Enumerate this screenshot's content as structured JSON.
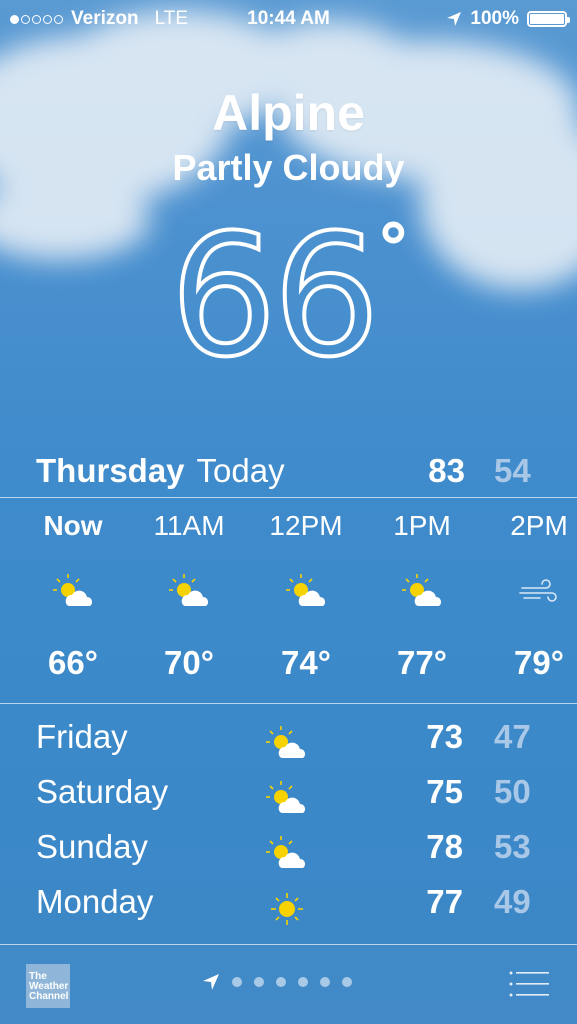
{
  "status_bar": {
    "carrier": "Verizon",
    "network": "LTE",
    "time": "10:44 AM",
    "battery": "100%",
    "signal_bars": 1
  },
  "location": {
    "city": "Alpine",
    "condition": "Partly Cloudy",
    "temperature": "66",
    "degree_symbol": "°"
  },
  "today": {
    "day": "Thursday",
    "label": "Today",
    "high": "83",
    "low": "54"
  },
  "hourly": [
    {
      "time": "Now",
      "icon": "partly-cloudy-icon",
      "temp": "66°"
    },
    {
      "time": "11AM",
      "icon": "partly-cloudy-icon",
      "temp": "70°"
    },
    {
      "time": "12PM",
      "icon": "partly-cloudy-icon",
      "temp": "74°"
    },
    {
      "time": "1PM",
      "icon": "partly-cloudy-icon",
      "temp": "77°"
    },
    {
      "time": "2PM",
      "icon": "wind-icon",
      "temp": "79°"
    }
  ],
  "daily": [
    {
      "day": "Friday",
      "icon": "partly-cloudy-icon",
      "high": "73",
      "low": "47"
    },
    {
      "day": "Saturday",
      "icon": "partly-cloudy-icon",
      "high": "75",
      "low": "50"
    },
    {
      "day": "Sunday",
      "icon": "partly-cloudy-icon",
      "high": "78",
      "low": "53"
    },
    {
      "day": "Monday",
      "icon": "sun-icon",
      "high": "77",
      "low": "49"
    }
  ],
  "bottom_bar": {
    "logo_text": [
      "The",
      "Weather",
      "Channel"
    ],
    "page_dots": 6,
    "icons": [
      "location-arrow-icon",
      "list-icon"
    ]
  },
  "colors": {
    "background": "#3f8bcb",
    "low_temp": "#a9c8e8",
    "sun": "#f5d200"
  }
}
